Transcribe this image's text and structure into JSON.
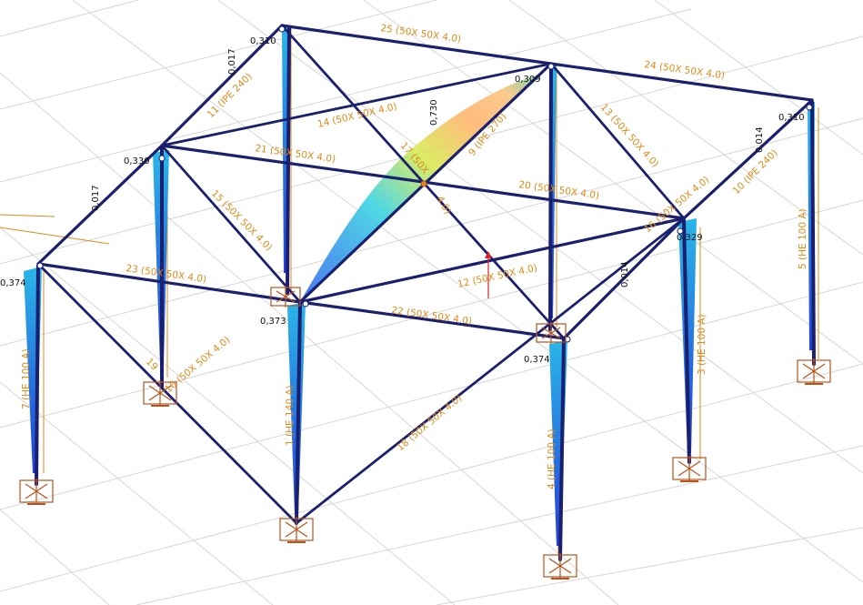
{
  "colors": {
    "member": "#1a1f6e",
    "label": "#e08a17",
    "support": "#b8531a",
    "grid": "#d6d6d6",
    "diagram_low": "#2a5cf0",
    "diagram_high": "#ff8a4a"
  },
  "members": {
    "m1": "1 (HE 140 A)",
    "m3": "3 (HE 100 A)",
    "m4": "4 (HE 100 A)",
    "m5": "5 (HE 100 A)",
    "m7": "7 (HE 100 A)",
    "m9": "9 (IPE 270)",
    "m10": "10 (IPE 240)",
    "m11": "11 (IPE 240)",
    "m12": "12 (50X 50X 4.0)",
    "m13": "13 (50X 50X 4.0)",
    "m14": "14 (50X 50X 4.0)",
    "m15": "15 (50X 50X 4.0)",
    "m16": "16 (50X 50X 4.0)",
    "m17": "17 (50X",
    "m18": "18 (50X 50X 4.0)",
    "m19": "19",
    "m20": "20 (50X 50X 4.0)",
    "m21": "21 (50X 50X 4.0)",
    "m22": "22 (50X 50X 4.0)",
    "m23": "23 (50X 50X 4.0)",
    "m24": "24 (50X 50X 4.0)",
    "m25": "25 (50X 50X 4.0)",
    "m9b": "4.0)"
  },
  "values": {
    "v_tl": "0,310",
    "v_tr": "0,309",
    "v_farright": "0,310",
    "v_leftmid": "0,330",
    "v_left": "0,374",
    "v_center": "0,373",
    "v_front": "0,374",
    "v_right": "0,329",
    "v_peak": "0,730",
    "v_beam1": "0,017",
    "v_beam2": "0,017",
    "v_beam3": "0,014",
    "v_beam4": "0,014"
  }
}
